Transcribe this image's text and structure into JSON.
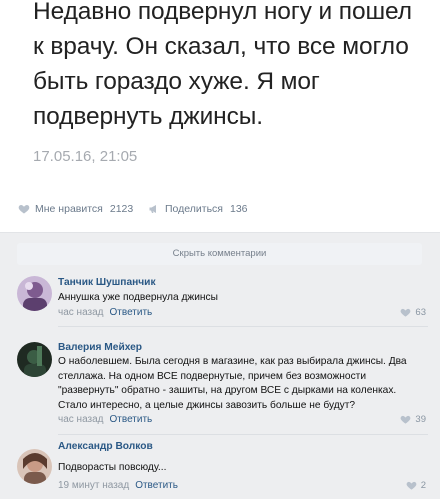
{
  "post": {
    "text": "Недавно подвернул ногу и пошел к врачу. Он сказал, что все могло быть гораздо хуже. Я мог подвернуть джинсы.",
    "date": "17.05.16, 21:05",
    "likes_label": "Мне нравится",
    "likes_count": "2123",
    "shares_label": "Поделиться",
    "shares_count": "136"
  },
  "hide_comments_label": "Скрыть комментарии",
  "comments": [
    {
      "author": "Танчик Шушпанчик",
      "text": "Аннушка уже подвернула джинсы",
      "time": "час назад",
      "reply": "Ответить",
      "likes": "63"
    },
    {
      "author": "Валерия Мейхер",
      "text": "О наболевшем. Была сегодня в магазине, как раз выбирала джинсы. Два стеллажа. На одном ВСЕ подвернутые, причем без возможности \"развернуть\" обратно - зашиты, на другом ВСЕ с дырками на коленках. Стало интересно, а целые джинсы завозить больше не будут?",
      "time": "час назад",
      "reply": "Ответить",
      "likes": "39"
    },
    {
      "author": "Александр Волков",
      "text": "Подворасты повсюду...",
      "time": "19 минут назад",
      "reply": "Ответить",
      "likes": "2"
    }
  ],
  "colors": {
    "link": "#2a5885",
    "muted": "#8f98a2",
    "bg": "#edeef0"
  }
}
